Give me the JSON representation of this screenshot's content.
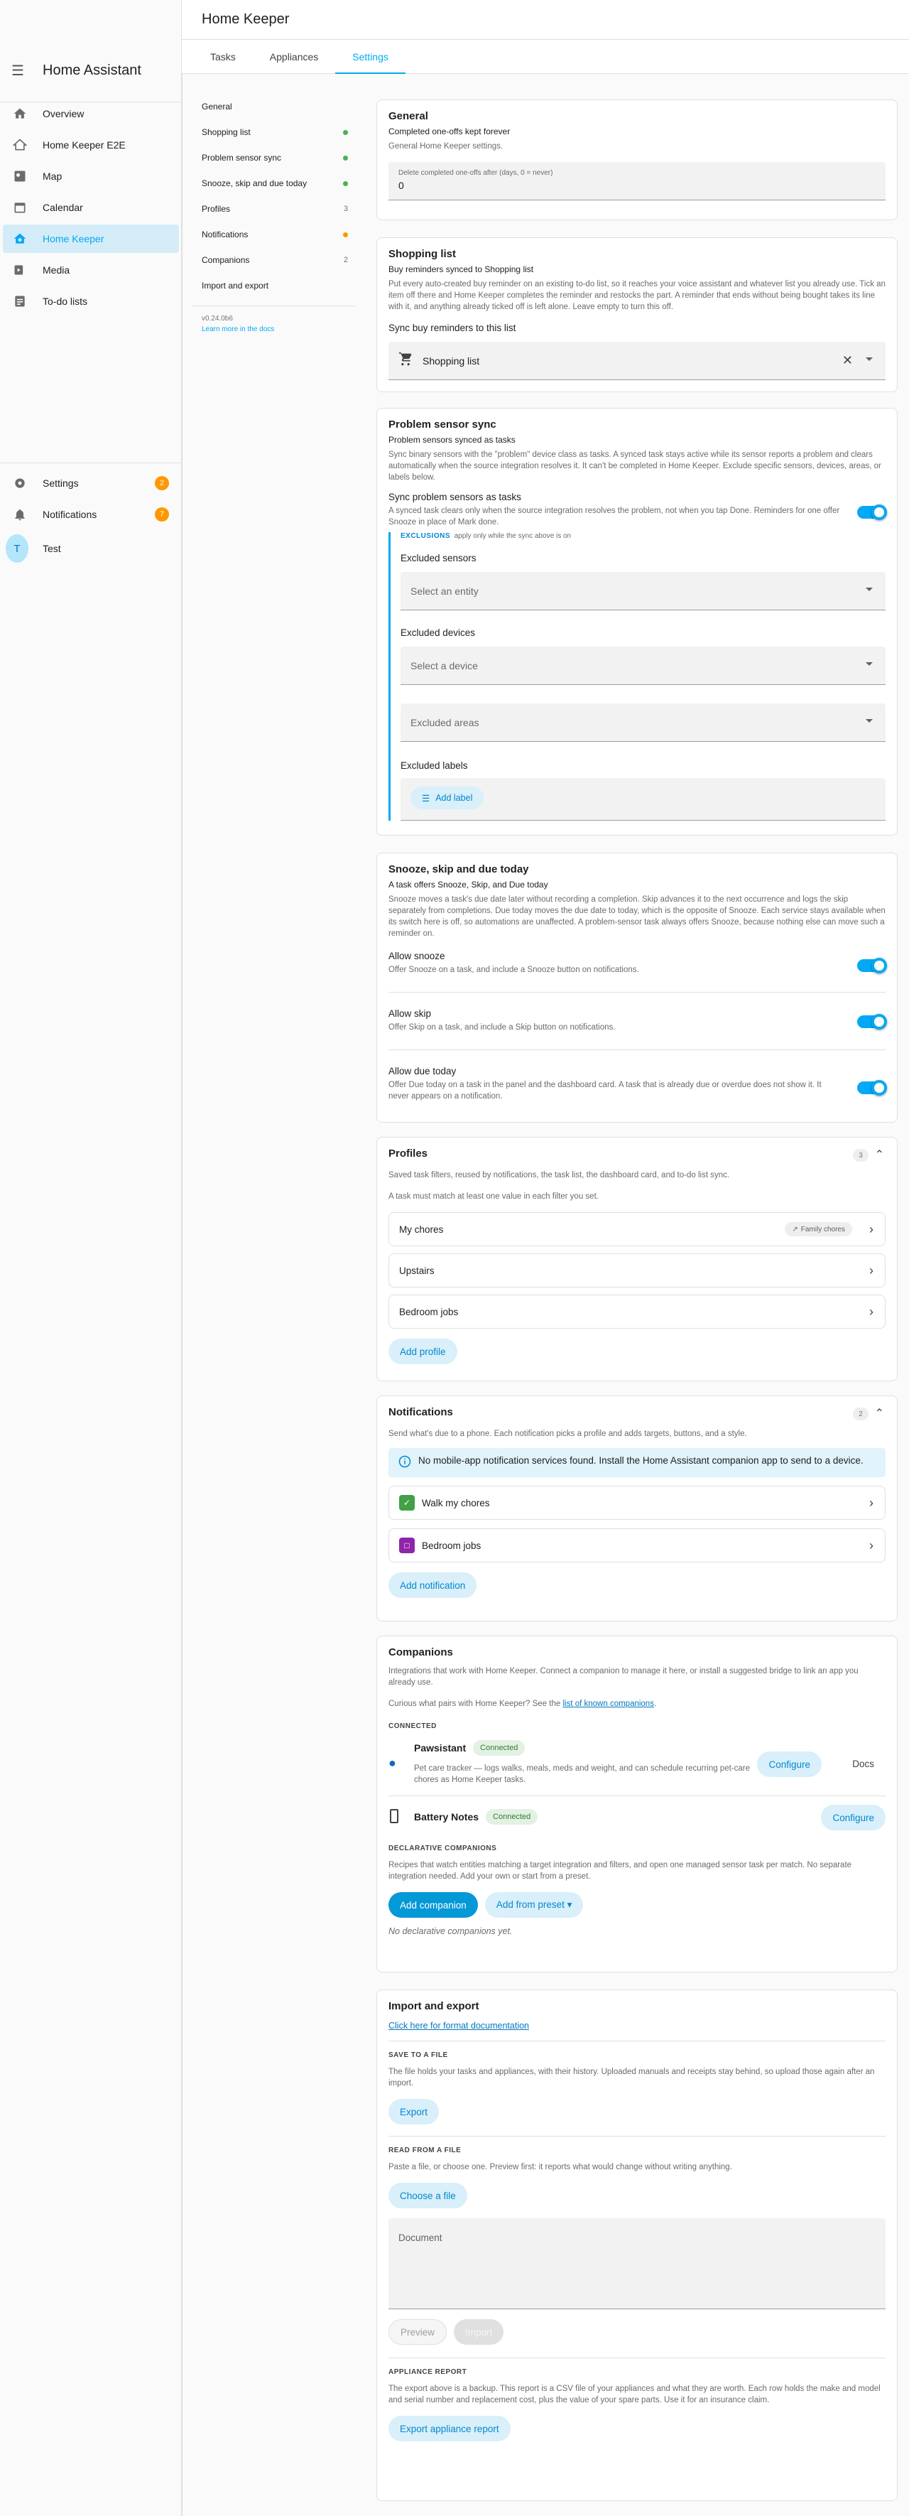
{
  "app": {
    "title": "Home Assistant",
    "page_title": "Home Keeper"
  },
  "sidebar": {
    "items": [
      {
        "label": "Overview"
      },
      {
        "label": "Home Keeper E2E"
      },
      {
        "label": "Map"
      },
      {
        "label": "Calendar"
      },
      {
        "label": "Home Keeper"
      },
      {
        "label": "Media"
      },
      {
        "label": "To-do lists"
      }
    ],
    "settings": {
      "label": "Settings",
      "badge": "2"
    },
    "notifications": {
      "label": "Notifications",
      "badge": "7"
    },
    "user": {
      "initial": "T",
      "name": "Test"
    }
  },
  "tabs": [
    {
      "label": "Tasks"
    },
    {
      "label": "Appliances"
    },
    {
      "label": "Settings"
    }
  ],
  "nav": {
    "items": [
      {
        "label": "General"
      },
      {
        "label": "Shopping list",
        "status": "#4caf50"
      },
      {
        "label": "Problem sensor sync",
        "status": "#4caf50"
      },
      {
        "label": "Snooze, skip and due today",
        "status": "#4caf50"
      },
      {
        "label": "Profiles",
        "count": "3"
      },
      {
        "label": "Notifications",
        "status": "#ff9800"
      },
      {
        "label": "Companions",
        "count": "2"
      },
      {
        "label": "Import and export"
      }
    ],
    "version": "v0.24.0b6",
    "docs_link": "Learn more in the docs"
  },
  "general": {
    "title": "General",
    "subtitle": "Completed one-offs kept forever",
    "desc": "General Home Keeper settings.",
    "field_label": "Delete completed one-offs after (days, 0 = never)",
    "field_value": "0"
  },
  "shopping": {
    "title": "Shopping list",
    "subtitle": "Buy reminders synced to Shopping list",
    "desc": "Put every auto-created buy reminder on an existing to-do list, so it reaches your voice assistant and whatever list you already use. Tick an item off there and Home Keeper completes the reminder and restocks the part. A reminder that ends without being bought takes its line with it, and anything already ticked off is left alone. Leave empty to turn this off.",
    "sync_label": "Sync buy reminders to this list",
    "list_value": "Shopping list"
  },
  "problem": {
    "title": "Problem sensor sync",
    "subtitle": "Problem sensors synced as tasks",
    "desc": "Sync binary sensors with the \"problem\" device class as tasks. A synced task stays active while its sensor reports a problem and clears automatically when the source integration resolves it. It can't be completed in Home Keeper. Exclude specific sensors, devices, areas, or labels below.",
    "toggle_label": "Sync problem sensors as tasks",
    "toggle_desc": "A synced task clears only when the source integration resolves the problem, not when you tap Done. Reminders for one offer Snooze in place of Mark done.",
    "exclusions_title": "EXCLUSIONS",
    "exclusions_note": "apply only while the sync above is on",
    "excluded_sensors": "Excluded sensors",
    "entity_placeholder": "Select an entity",
    "excluded_devices": "Excluded devices",
    "device_placeholder": "Select a device",
    "areas_placeholder": "Excluded areas",
    "excluded_labels": "Excluded labels",
    "add_label": "Add label"
  },
  "snooze": {
    "title": "Snooze, skip and due today",
    "subtitle": "A task offers Snooze, Skip, and Due today",
    "desc": "Snooze moves a task's due date later without recording a completion. Skip advances it to the next occurrence and logs the skip separately from completions. Due today moves the due date to today, which is the opposite of Snooze. Each service stays available when its switch here is off, so automations are unaffected. A problem-sensor task always offers Snooze, because nothing else can move such a reminder on.",
    "options": [
      {
        "label": "Allow snooze",
        "desc": "Offer Snooze on a task, and include a Snooze button on notifications."
      },
      {
        "label": "Allow skip",
        "desc": "Offer Skip on a task, and include a Skip button on notifications."
      },
      {
        "label": "Allow due today",
        "desc": "Offer Due today on a task in the panel and the dashboard card. A task that is already due or overdue does not show it. It never appears on a notification."
      }
    ]
  },
  "profiles": {
    "title": "Profiles",
    "count": "3",
    "desc1": "Saved task filters, reused by notifications, the task list, the dashboard card, and to-do list sync.",
    "desc2": "A task must match at least one value in each filter you set.",
    "items": [
      {
        "label": "My chores",
        "tag": "Family chores"
      },
      {
        "label": "Upstairs"
      },
      {
        "label": "Bedroom jobs"
      }
    ],
    "add": "Add profile"
  },
  "notifications": {
    "title": "Notifications",
    "count": "2",
    "desc": "Send what's due to a phone. Each notification picks a profile and adds targets, buttons, and a style.",
    "info": "No mobile-app notification services found. Install the Home Assistant companion app to send to a device.",
    "items": [
      {
        "label": "Walk my chores",
        "color": "#43a047"
      },
      {
        "label": "Bedroom jobs",
        "color": "#8e24aa"
      }
    ],
    "add": "Add notification"
  },
  "companions": {
    "title": "Companions",
    "desc": "Integrations that work with Home Keeper. Connect a companion to manage it here, or install a suggested bridge to link an app you already use.",
    "curious": "Curious what pairs with Home Keeper? See the",
    "curious_link": "list of known companions",
    "connected_caption": "CONNECTED",
    "pawsistant": {
      "name": "Pawsistant",
      "status": "Connected",
      "desc": "Pet care tracker — logs walks, meals, meds and weight, and can schedule recurring pet-care chores as Home Keeper tasks.",
      "configure": "Configure",
      "docs": "Docs"
    },
    "battery": {
      "name": "Battery Notes",
      "status": "Connected",
      "configure": "Configure"
    },
    "declarative_caption": "DECLARATIVE COMPANIONS",
    "declarative_desc": "Recipes that watch entities matching a target integration and filters, and open one managed sensor task per match. No separate integration needed. Add your own or start from a preset.",
    "add_companion": "Add companion",
    "add_preset": "Add from preset ▾",
    "empty": "No declarative companions yet."
  },
  "import_export": {
    "title": "Import and export",
    "doc_link": "Click here for format documentation",
    "save_caption": "SAVE TO A FILE",
    "save_desc": "The file holds your tasks and appliances, with their history. Uploaded manuals and receipts stay behind, so upload those again after an import.",
    "export": "Export",
    "read_caption": "READ FROM A FILE",
    "read_desc": "Paste a file, or choose one. Preview first: it reports what would change without writing anything.",
    "choose": "Choose a file",
    "document_label": "Document",
    "preview": "Preview",
    "import": "Import",
    "appliance_caption": "APPLIANCE REPORT",
    "appliance_desc": "The export above is a backup. This report is a CSV file of your appliances and what they are worth. Each row holds the make and model and serial number and replacement cost, plus the value of your spare parts. Use it for an insurance claim.",
    "appliance_button": "Export appliance report"
  }
}
